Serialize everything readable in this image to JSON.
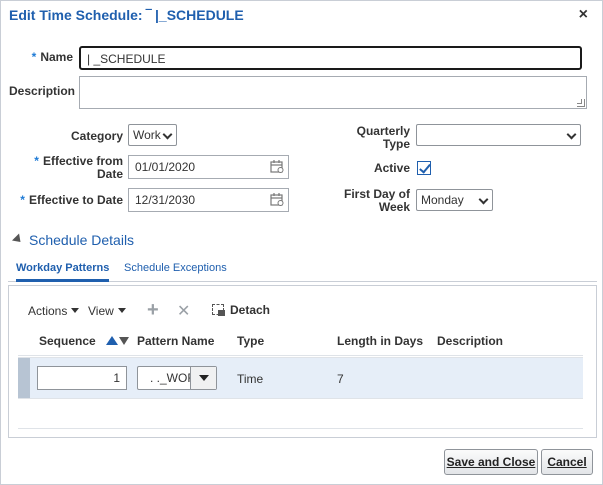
{
  "dialog": {
    "title": "Edit Time Schedule: ‾ |_SCHEDULE",
    "close_glyph": "×"
  },
  "form": {
    "name": {
      "label": "Name",
      "required_mark": "*",
      "value": "|    _SCHEDULE"
    },
    "description": {
      "label": "Description",
      "value": ""
    },
    "category": {
      "label": "Category",
      "value": "Work"
    },
    "effective_from": {
      "label_line1": "Effective from",
      "label_line2": "Date",
      "required_mark": "*",
      "value": "01/01/2020"
    },
    "effective_to": {
      "label": "Effective to Date",
      "required_mark": "*",
      "value": "12/31/2030"
    },
    "quarterly_type": {
      "label_line1": "Quarterly",
      "label_line2": "Type",
      "value": ""
    },
    "active": {
      "label": "Active",
      "checked": true
    },
    "first_day_of_week": {
      "label_line1": "First Day of",
      "label_line2": "Week",
      "value": "Monday"
    }
  },
  "section": {
    "title": "Schedule Details",
    "tabs": [
      {
        "label": "Workday Patterns",
        "active": true
      },
      {
        "label": "Schedule Exceptions",
        "active": false
      }
    ]
  },
  "toolbar": {
    "actions_label": "Actions",
    "view_label": "View",
    "add_glyph": "+",
    "delete_glyph": "✕",
    "detach_label": "Detach"
  },
  "table": {
    "columns": [
      "Sequence",
      "Pattern Name",
      "Type",
      "Length in Days",
      "Description"
    ],
    "rows": [
      {
        "sequence": "1",
        "pattern_name": ". ._WOR",
        "type": "Time",
        "length_in_days": "7",
        "description": ""
      }
    ]
  },
  "buttons": {
    "save_and_close": "Save and Close",
    "cancel": "Cancel"
  },
  "colors": {
    "accent": "#1f5fae",
    "row_selected": "#e6eef8"
  }
}
